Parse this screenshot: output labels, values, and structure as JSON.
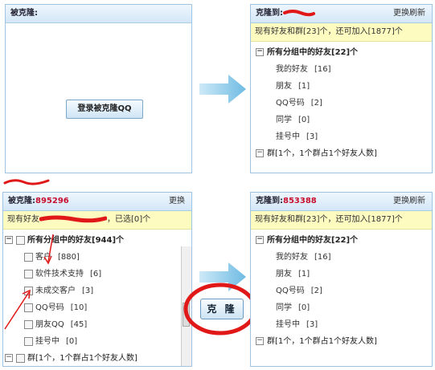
{
  "p1": {
    "title": "被克隆:",
    "login_button": "登录被克隆QQ"
  },
  "p2": {
    "title": "克隆到:",
    "title_num": "853388",
    "refresh": "更换刷新",
    "info": "现有好友和群[23]个，还可加入[1877]个",
    "group_label": "所有分组中的好友",
    "group_count": "[22]个",
    "items": [
      {
        "label": "我的好友",
        "count": "[16]"
      },
      {
        "label": "朋友",
        "count": "[1]"
      },
      {
        "label": "QQ号码",
        "count": "[2]"
      },
      {
        "label": "同学",
        "count": "[0]"
      },
      {
        "label": "挂号中",
        "count": "[3]"
      }
    ],
    "group2": "群[1个，1个群占1个好友人数]"
  },
  "p3": {
    "title": "被克隆:",
    "title_num": "895296",
    "switch": "更换",
    "info_left": "现有好友",
    "info_right": "，已选[0]个",
    "group_label": "所有分组中的好友",
    "group_count": "[944]个",
    "items": [
      {
        "label": "客户",
        "count": "[880]"
      },
      {
        "label": "软件技术支持",
        "count": "[6]"
      },
      {
        "label": "未成交客户",
        "count": "[3]"
      },
      {
        "label": "QQ号码",
        "count": "[10]"
      },
      {
        "label": "朋友QQ",
        "count": "[45]"
      },
      {
        "label": "挂号中",
        "count": "[0]"
      }
    ],
    "group2": "群[1个，1个群占1个好友人数]"
  },
  "p4": {
    "title": "克隆到:",
    "title_num": "853388",
    "refresh": "更换刷新",
    "info": "现有好友和群[23]个，还可加入[1877]个",
    "group_label": "所有分组中的好友",
    "group_count": "[22]个",
    "items": [
      {
        "label": "我的好友",
        "count": "[16]"
      },
      {
        "label": "朋友",
        "count": "[1]"
      },
      {
        "label": "QQ号码",
        "count": "[2]"
      },
      {
        "label": "同学",
        "count": "[0]"
      },
      {
        "label": "挂号中",
        "count": "[3]"
      }
    ],
    "group2": "群[1个，1个群占1个好友人数]"
  },
  "clone_button": "克 隆",
  "colors": {
    "accent_red": "#e01818",
    "arrow_blue": "#7ec3e6",
    "header_border": "#9fc3e0",
    "info_bg": "#fdfbc0"
  }
}
